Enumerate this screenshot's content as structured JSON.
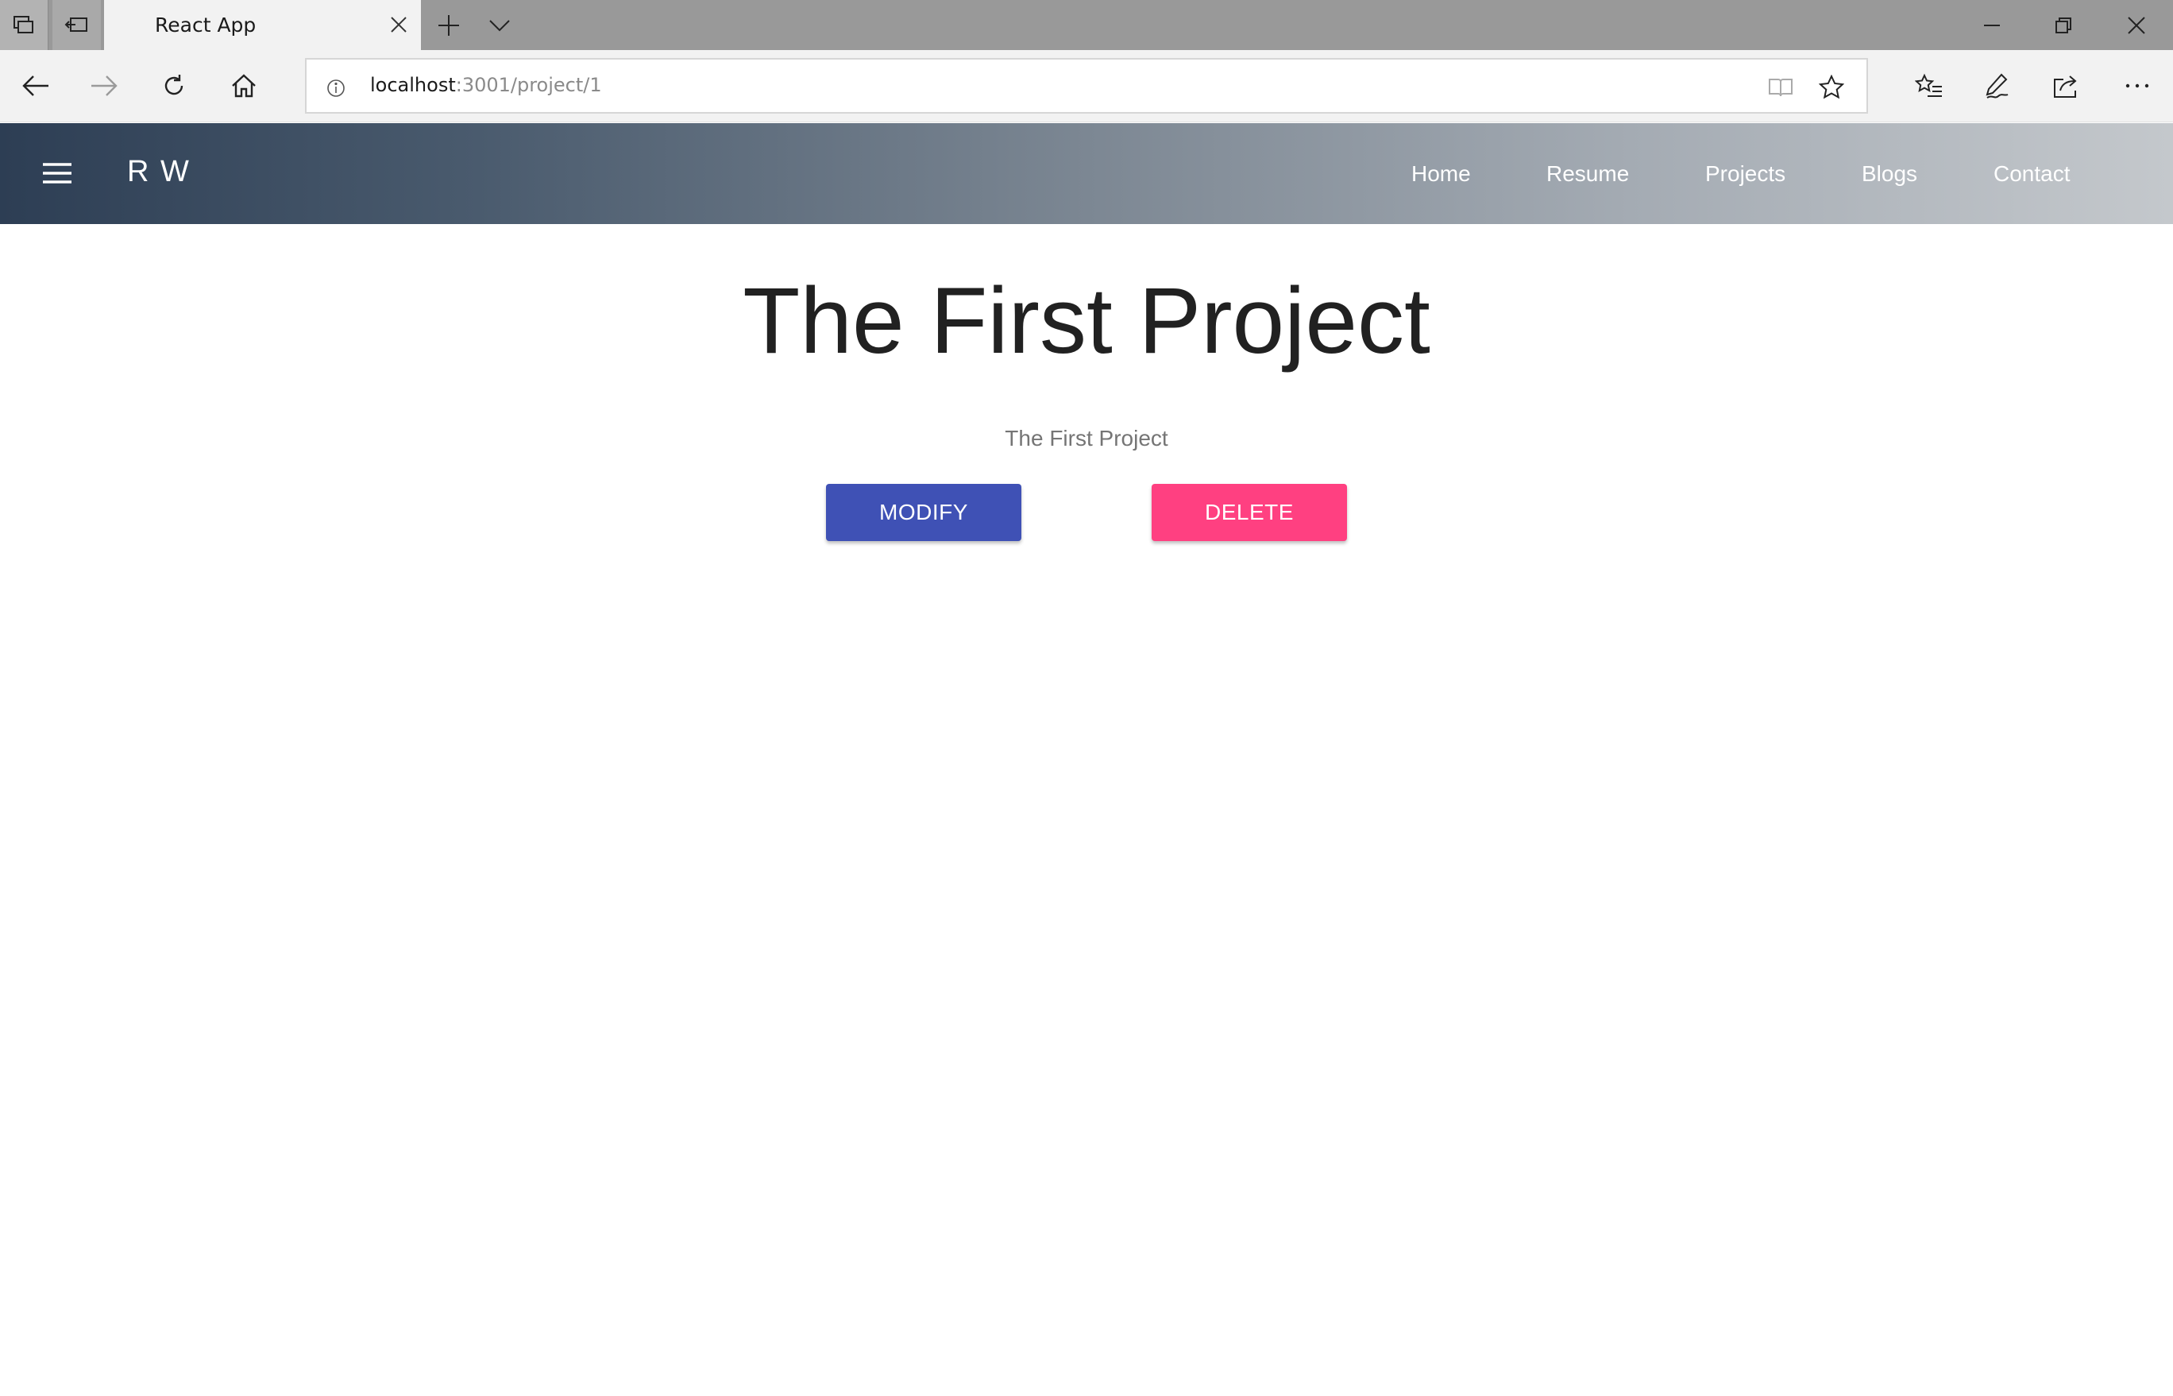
{
  "browser": {
    "tab": {
      "title": "React App"
    },
    "address": {
      "host": "localhost",
      "path": ":3001/project/1"
    },
    "icons": {
      "tab_actions": "tab-actions-icon",
      "set_aside": "set-aside-tabs-icon",
      "close_tab": "close-icon",
      "new_tab": "plus-icon",
      "tab_list": "chevron-down-icon",
      "back": "back-arrow-icon",
      "forward": "forward-arrow-icon",
      "refresh": "refresh-icon",
      "home": "home-icon",
      "site_info": "info-icon",
      "reading_view": "book-icon",
      "favorite": "star-icon",
      "favorites_hub": "favorites-list-icon",
      "web_note": "pen-icon",
      "share": "share-icon",
      "more": "more-icon"
    }
  },
  "app": {
    "brand": "R W",
    "nav": [
      "Home",
      "Resume",
      "Projects",
      "Blogs",
      "Contact"
    ]
  },
  "main": {
    "title": "The First Project",
    "subtitle": "The First Project",
    "modify_label": "MODIFY",
    "delete_label": "DELETE"
  },
  "colors": {
    "primary": "#3f51b5",
    "secondary": "#ff4081",
    "appbar_start": "#2d3e54",
    "appbar_end": "#c4c8cc"
  }
}
